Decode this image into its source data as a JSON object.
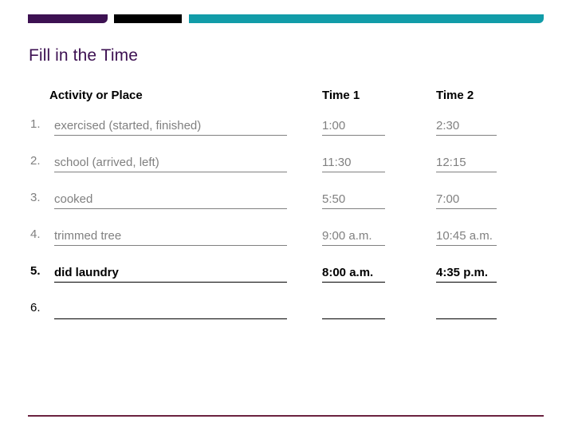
{
  "slide": {
    "title": "Fill in the Time",
    "title_color": "#3d1152"
  },
  "decor": {
    "bar_purple_color": "#3d1152",
    "bar_black_color": "#000000",
    "bar_teal_color": "#119ca8",
    "bottom_rule_color": "#6b2340"
  },
  "table": {
    "headers": {
      "activity": "Activity or Place",
      "time1": "Time 1",
      "time2": "Time 2"
    },
    "rows": [
      {
        "number": "1.",
        "activity": "exercised (started, finished)",
        "time1": "1:00",
        "time2": "2:30",
        "style": "gray"
      },
      {
        "number": "2.",
        "activity": "school (arrived, left)",
        "time1": "11:30",
        "time2": "12:15",
        "style": "gray"
      },
      {
        "number": "3.",
        "activity": "cooked",
        "time1": "5:50",
        "time2": "7:00",
        "style": "gray"
      },
      {
        "number": "4.",
        "activity": "trimmed tree",
        "time1": "9:00 a.m.",
        "time2": "10:45 a.m.",
        "style": "gray"
      },
      {
        "number": "5.",
        "activity": "did laundry",
        "time1": "8:00 a.m.",
        "time2": "4:35 p.m.",
        "style": "bold"
      },
      {
        "number": "6.",
        "activity": "",
        "time1": "",
        "time2": "",
        "style": "blank"
      }
    ]
  }
}
